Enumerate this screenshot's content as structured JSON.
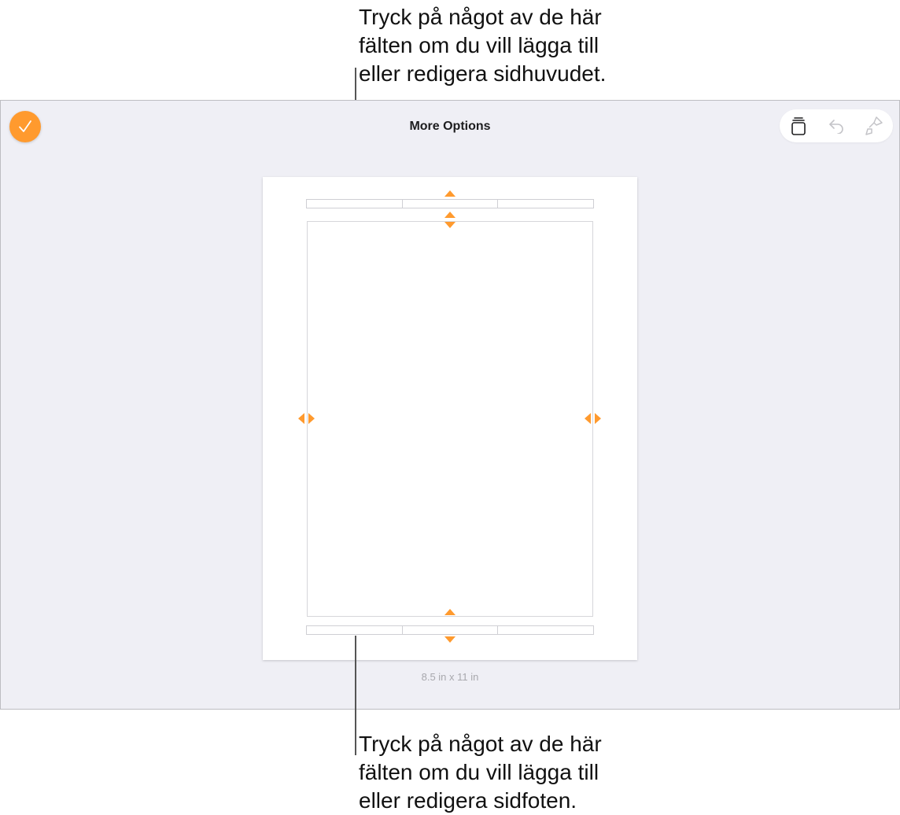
{
  "callouts": {
    "header_text": "Tryck på något av de här\nfälten om du vill lägga till\neller redigera sidhuvudet.",
    "footer_text": "Tryck på något av de här\nfälten om du vill lägga till\neller redigera sidfoten."
  },
  "screen": {
    "title": "More Options",
    "page_size_label": "8.5 in x 11 in",
    "accent_color": "#ff9a2e",
    "background_color": "#efeff5"
  },
  "icons": {
    "done": "checkmark-icon",
    "toolbar": [
      "page-copy-icon",
      "undo-icon",
      "paintbrush-icon"
    ]
  }
}
